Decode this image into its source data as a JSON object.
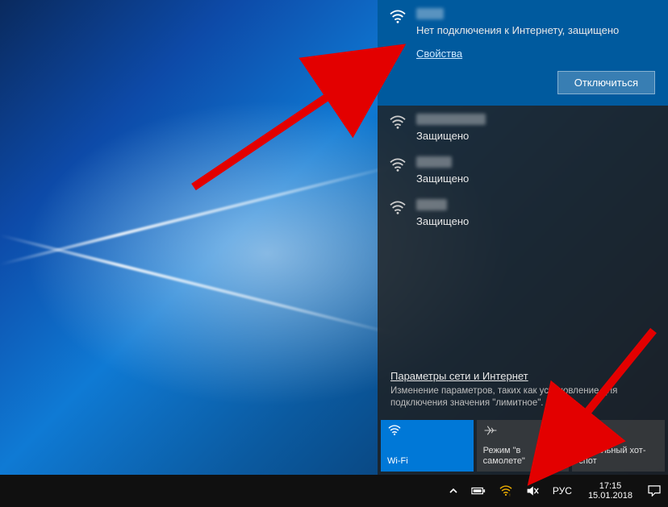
{
  "flyout": {
    "current": {
      "status": "Нет подключения к Интернету, защищено",
      "properties_label": "Свойства",
      "disconnect_label": "Отключиться"
    },
    "other": {
      "status": "Защищено"
    },
    "settings": {
      "link": "Параметры сети и Интернет",
      "description": "Изменение параметров, таких как установление для подключения значения \"лимитное\"."
    },
    "tiles": {
      "wifi": "Wi-Fi",
      "airplane": "Режим \"в самолете\"",
      "hotspot": "Мобильный хот-спот"
    }
  },
  "taskbar": {
    "lang": "РУС",
    "time": "17:15",
    "date": "15.01.2018"
  }
}
